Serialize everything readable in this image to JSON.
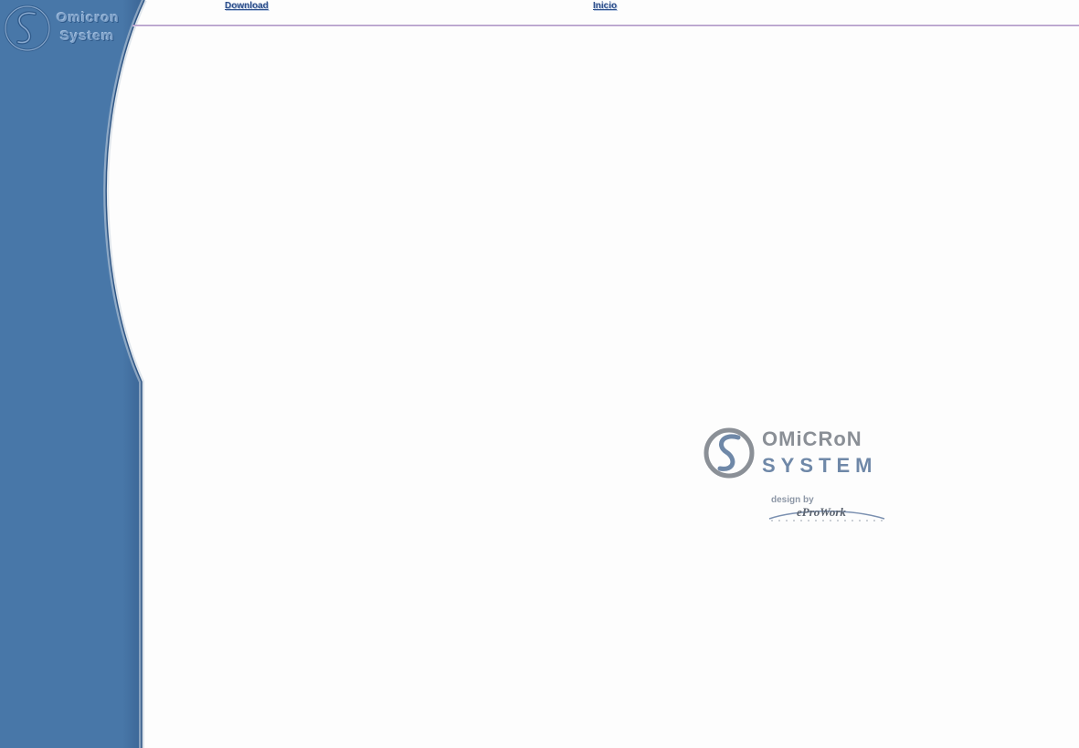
{
  "sidebar": {
    "logo_text_line1": "Omicron",
    "logo_text_line2": "System",
    "logo_icon": "s-circle-logo-icon"
  },
  "nav": {
    "download_label": "Download",
    "inicio_label": "Inicio"
  },
  "main": {
    "logo_line1": "OMiCRoN",
    "logo_line2": "SYSTEM",
    "logo_icon": "s-circle-logo-icon",
    "credit_label": "design by",
    "credit_brand": "eProWork"
  },
  "colors": {
    "sidebar_blue": "#4877a8",
    "rule_purple": "#9a7fb6",
    "link_blue": "#2e4f8a",
    "page_background": "#fdfdfd"
  }
}
